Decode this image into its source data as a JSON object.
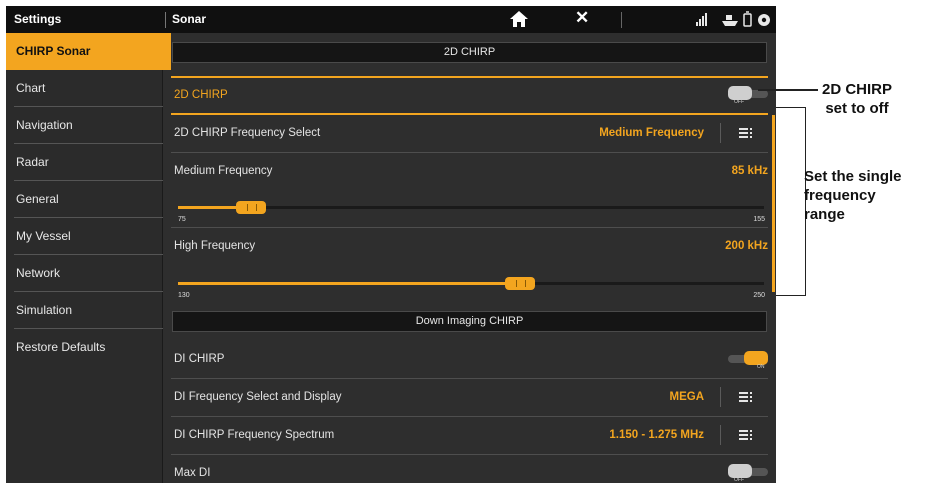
{
  "topbar": {
    "left_title": "Settings",
    "right_title": "Sonar",
    "home_icon": "home-icon",
    "close_symbol": "✕"
  },
  "sidebar": {
    "items": [
      {
        "label": "CHIRP Sonar",
        "active": true
      },
      {
        "label": "Chart"
      },
      {
        "label": "Navigation"
      },
      {
        "label": "Radar"
      },
      {
        "label": "General"
      },
      {
        "label": "My Vessel"
      },
      {
        "label": "Network"
      },
      {
        "label": "Simulation"
      },
      {
        "label": "Restore Defaults"
      }
    ]
  },
  "main": {
    "section_2d": "2D CHIRP",
    "row_2d_chirp": {
      "label": "2D CHIRP",
      "toggle_state": "OFF"
    },
    "row_freq_select": {
      "label": "2D CHIRP Frequency Select",
      "value": "Medium Frequency"
    },
    "row_medium": {
      "label": "Medium Frequency",
      "value": "85 kHz"
    },
    "slider_medium": {
      "min": "75",
      "max": "155",
      "position": 0.125
    },
    "row_high": {
      "label": "High Frequency",
      "value": "200 kHz"
    },
    "slider_high": {
      "min": "130",
      "max": "250",
      "position": 0.583
    },
    "section_di": "Down Imaging CHIRP",
    "row_di_chirp": {
      "label": "DI CHIRP",
      "toggle_state": "ON"
    },
    "row_di_freq": {
      "label": "DI Frequency Select and Display",
      "value": "MEGA"
    },
    "row_di_spectrum": {
      "label": "DI CHIRP Frequency Spectrum",
      "value": "1.150 - 1.275 MHz"
    },
    "row_max_di": {
      "label": "Max DI",
      "toggle_state": "OFF"
    }
  },
  "callouts": {
    "top_line1": "2D CHIRP",
    "top_line2": "set to off",
    "side_line1": "Set the single",
    "side_line2": "frequency",
    "side_line3": "range"
  },
  "colors": {
    "accent": "#f3a51f",
    "background": "#2e2e2e",
    "topbar": "#101010"
  }
}
